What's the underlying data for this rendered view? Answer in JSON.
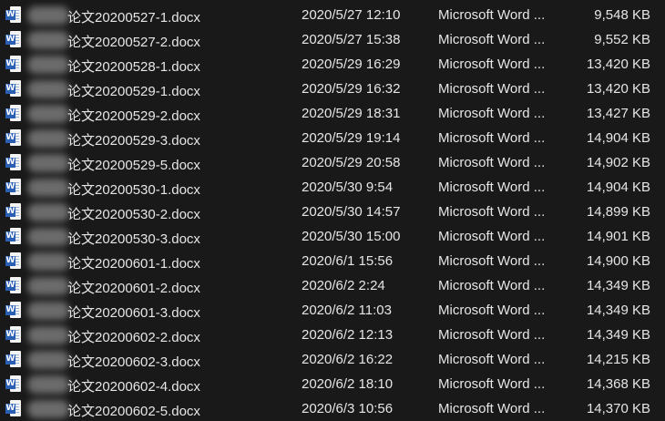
{
  "files": [
    {
      "name": "论文20200527-1.docx",
      "modified": "2020/5/27 12:10",
      "type": "Microsoft Word ...",
      "size": "9,548 KB"
    },
    {
      "name": "论文20200527-2.docx",
      "modified": "2020/5/27 15:38",
      "type": "Microsoft Word ...",
      "size": "9,552 KB"
    },
    {
      "name": "论文20200528-1.docx",
      "modified": "2020/5/29 16:29",
      "type": "Microsoft Word ...",
      "size": "13,420 KB"
    },
    {
      "name": "论文20200529-1.docx",
      "modified": "2020/5/29 16:32",
      "type": "Microsoft Word ...",
      "size": "13,420 KB"
    },
    {
      "name": "论文20200529-2.docx",
      "modified": "2020/5/29 18:31",
      "type": "Microsoft Word ...",
      "size": "13,427 KB"
    },
    {
      "name": "论文20200529-3.docx",
      "modified": "2020/5/29 19:14",
      "type": "Microsoft Word ...",
      "size": "14,904 KB"
    },
    {
      "name": "论文20200529-5.docx",
      "modified": "2020/5/29 20:58",
      "type": "Microsoft Word ...",
      "size": "14,902 KB"
    },
    {
      "name": "论文20200530-1.docx",
      "modified": "2020/5/30 9:54",
      "type": "Microsoft Word ...",
      "size": "14,904 KB"
    },
    {
      "name": "论文20200530-2.docx",
      "modified": "2020/5/30 14:57",
      "type": "Microsoft Word ...",
      "size": "14,899 KB"
    },
    {
      "name": "论文20200530-3.docx",
      "modified": "2020/5/30 15:00",
      "type": "Microsoft Word ...",
      "size": "14,901 KB"
    },
    {
      "name": "论文20200601-1.docx",
      "modified": "2020/6/1 15:56",
      "type": "Microsoft Word ...",
      "size": "14,900 KB"
    },
    {
      "name": "论文20200601-2.docx",
      "modified": "2020/6/2 2:24",
      "type": "Microsoft Word ...",
      "size": "14,349 KB"
    },
    {
      "name": "论文20200601-3.docx",
      "modified": "2020/6/2 11:03",
      "type": "Microsoft Word ...",
      "size": "14,349 KB"
    },
    {
      "name": "论文20200602-2.docx",
      "modified": "2020/6/2 12:13",
      "type": "Microsoft Word ...",
      "size": "14,349 KB"
    },
    {
      "name": "论文20200602-3.docx",
      "modified": "2020/6/2 16:22",
      "type": "Microsoft Word ...",
      "size": "14,215 KB"
    },
    {
      "name": "论文20200602-4.docx",
      "modified": "2020/6/2 18:10",
      "type": "Microsoft Word ...",
      "size": "14,368 KB"
    },
    {
      "name": "论文20200602-5.docx",
      "modified": "2020/6/3 10:56",
      "type": "Microsoft Word ...",
      "size": "14,370 KB"
    }
  ],
  "icon": {
    "name": "word-document-icon",
    "badge": "W",
    "color": "#2b5fb4"
  }
}
